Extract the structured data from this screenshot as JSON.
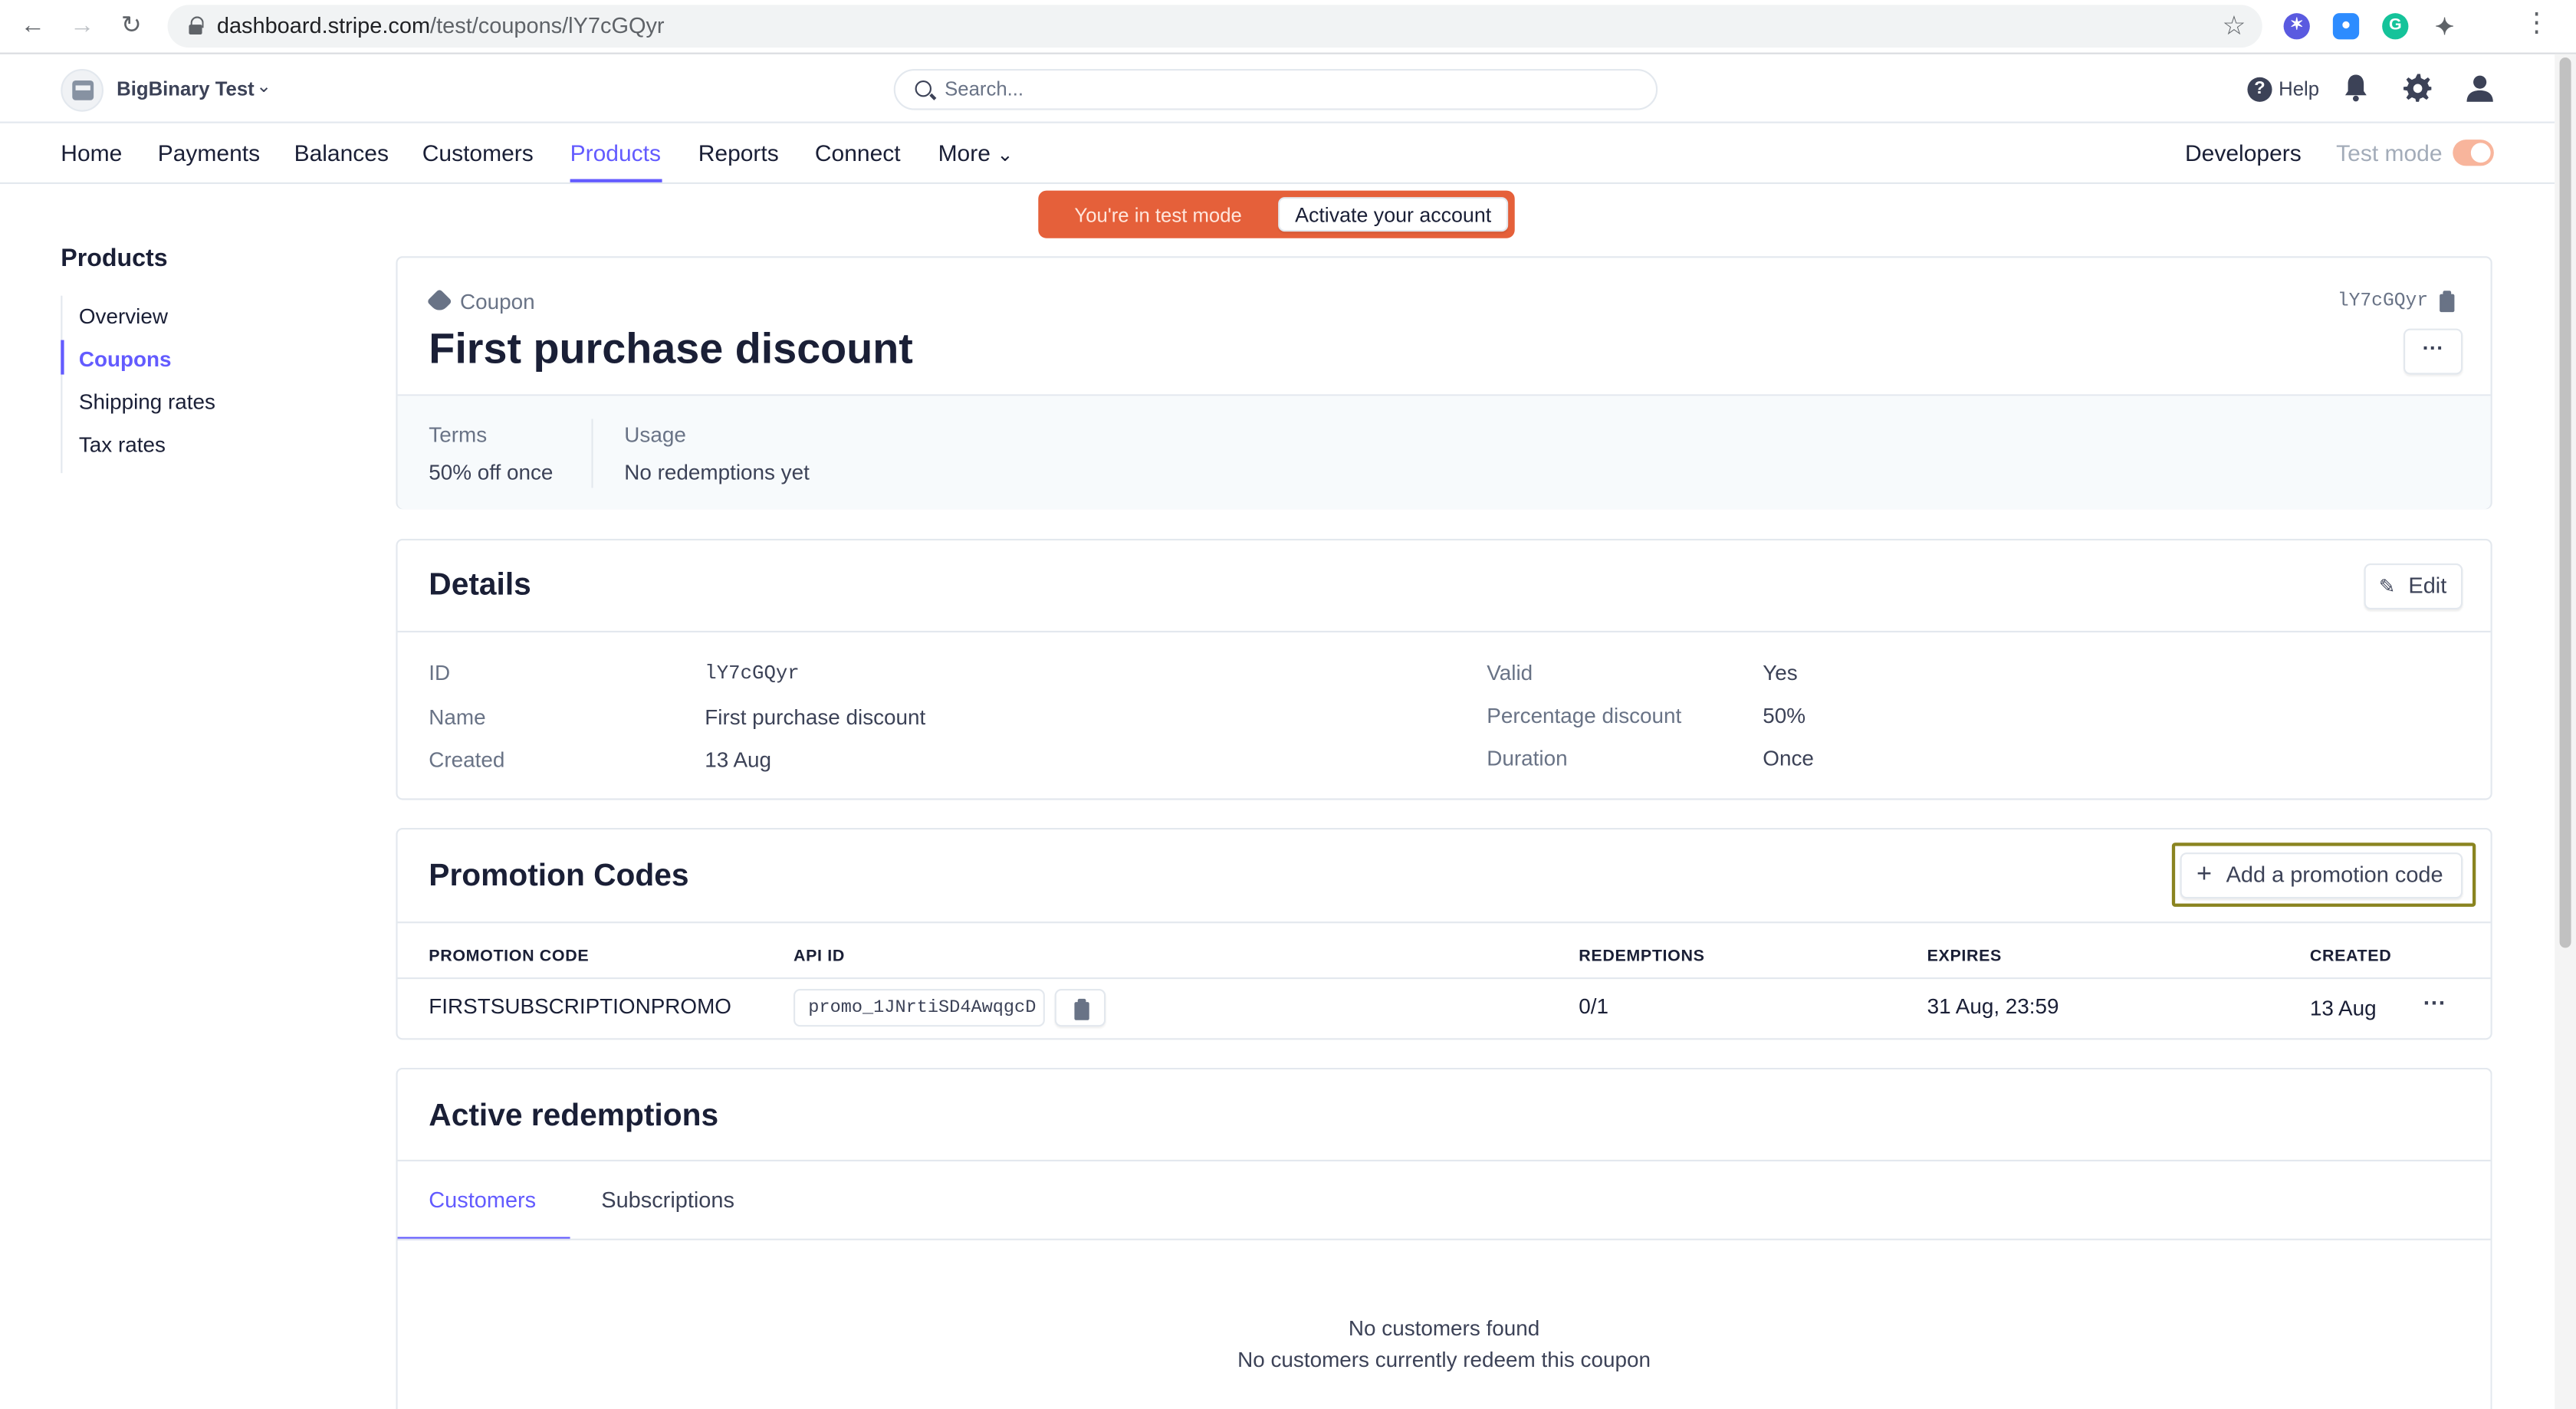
{
  "browser": {
    "url_host": "dashboard.stripe.com",
    "url_path": "/test/coupons/lY7cGQyr"
  },
  "header": {
    "account_name": "BigBinary Test",
    "search_placeholder": "Search...",
    "help_label": "Help"
  },
  "nav": {
    "items": [
      "Home",
      "Payments",
      "Balances",
      "Customers",
      "Products",
      "Reports",
      "Connect",
      "More"
    ],
    "active": "Products",
    "developers_label": "Developers",
    "test_mode_label": "Test mode"
  },
  "banner": {
    "text": "You're in test mode",
    "button": "Activate your account"
  },
  "sidebar": {
    "title": "Products",
    "items": [
      "Overview",
      "Coupons",
      "Shipping rates",
      "Tax rates"
    ],
    "active": "Coupons"
  },
  "coupon": {
    "kicker": "Coupon",
    "title": "First purchase discount",
    "id_chip": "lY7cGQyr",
    "terms_label": "Terms",
    "terms_value": "50% off once",
    "usage_label": "Usage",
    "usage_value": "No redemptions yet"
  },
  "details": {
    "title": "Details",
    "edit_label": "Edit",
    "left": [
      {
        "label": "ID",
        "value": "lY7cGQyr"
      },
      {
        "label": "Name",
        "value": "First purchase discount"
      },
      {
        "label": "Created",
        "value": "13 Aug"
      }
    ],
    "right": [
      {
        "label": "Valid",
        "value": "Yes"
      },
      {
        "label": "Percentage discount",
        "value": "50%"
      },
      {
        "label": "Duration",
        "value": "Once"
      }
    ]
  },
  "promo": {
    "title": "Promotion Codes",
    "add_label": "Add a promotion code",
    "columns": [
      "PROMOTION CODE",
      "API ID",
      "REDEMPTIONS",
      "EXPIRES",
      "CREATED"
    ],
    "rows": [
      {
        "code": "FIRSTSUBSCRIPTIONPROMO",
        "api_id": "promo_1JNrtiSD4AwqgcD",
        "redemptions": "0/1",
        "expires": "31 Aug, 23:59",
        "created": "13 Aug"
      }
    ]
  },
  "redemptions": {
    "title": "Active redemptions",
    "tabs": [
      "Customers",
      "Subscriptions"
    ],
    "active_tab": "Customers",
    "empty_title": "No customers found",
    "empty_sub": "No customers currently redeem this coupon"
  },
  "colors": {
    "accent": "#635bff",
    "banner": "#e5603a"
  }
}
